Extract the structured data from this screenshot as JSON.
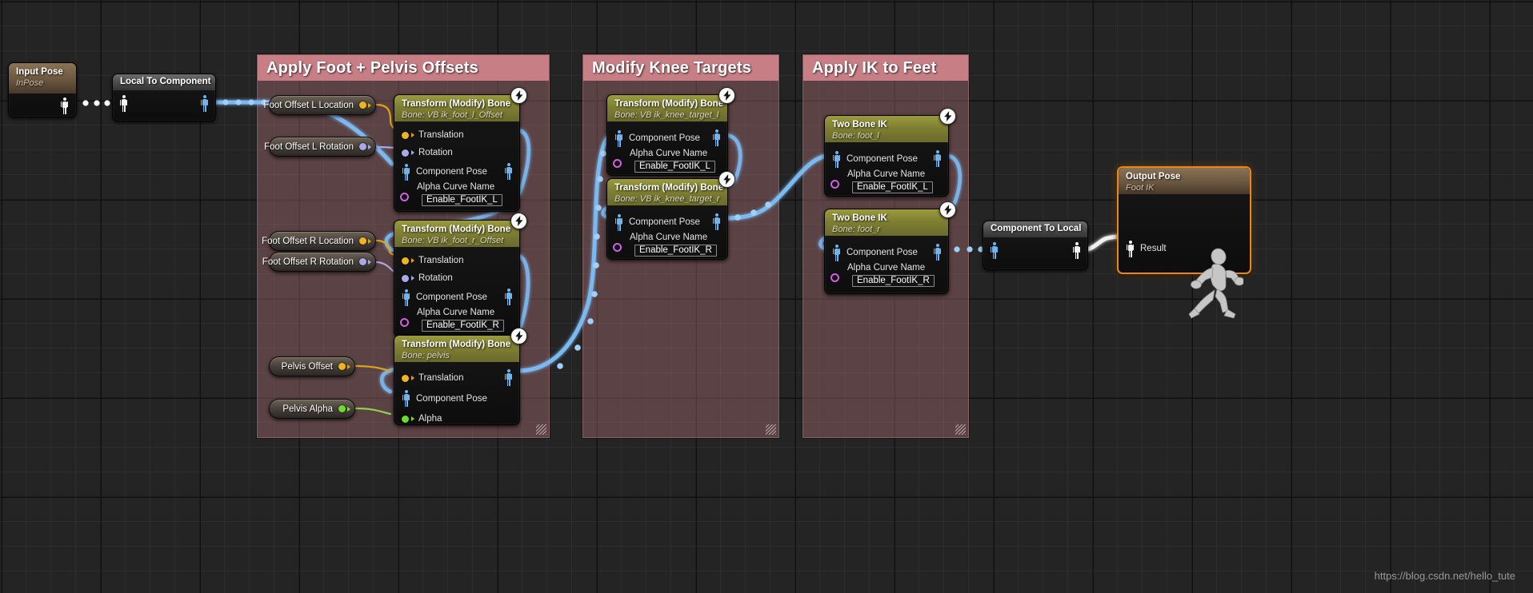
{
  "watermark": "https://blog.csdn.net/hello_tute",
  "colors": {
    "comment_fill": "#aa6e73",
    "comment_title_bar": "#c77e85",
    "node_header_olive": "#8f8f39",
    "node_header_grey": "#4a4a4a",
    "node_header_tan": "#6b5740",
    "result_border": "#e8871a",
    "pin_vector": "#f0b41e",
    "pin_rotator": "#a9a9e8",
    "pin_float": "#6cdb2a",
    "pin_name": "#d060e0",
    "pose_component": "#6fb4ef",
    "pose_local": "#f2f2f2",
    "background": "#242424"
  },
  "comments": [
    {
      "title": "Apply Foot + Pelvis Offsets"
    },
    {
      "title": "Modify Knee Targets"
    },
    {
      "title": "Apply IK to Feet"
    }
  ],
  "nodes": {
    "input_pose": {
      "title": "Input Pose",
      "subtitle": "InPose",
      "out_pin": "pose-local"
    },
    "local_to_component": {
      "title": "Local To Component",
      "in_pin": "pose-local",
      "out_pin": "pose-component"
    },
    "component_to_local": {
      "title": "Component To Local",
      "in_pin": "pose-component",
      "out_pin": "pose-local"
    },
    "output_pose": {
      "title": "Output Pose",
      "subtitle": "Foot IK",
      "result_label": "Result"
    },
    "transform_foot_l": {
      "title": "Transform (Modify) Bone",
      "subtitle": "Bone: VB ik_foot_l_Offset",
      "pins": [
        "Translation",
        "Rotation",
        "Component Pose"
      ],
      "curve_label": "Alpha Curve Name",
      "curve_value": "Enable_FootIK_L"
    },
    "transform_foot_r": {
      "title": "Transform (Modify) Bone",
      "subtitle": "Bone: VB ik_foot_r_Offset",
      "pins": [
        "Translation",
        "Rotation",
        "Component Pose"
      ],
      "curve_label": "Alpha Curve Name",
      "curve_value": "Enable_FootIK_R"
    },
    "transform_pelvis": {
      "title": "Transform (Modify) Bone",
      "subtitle": "Bone: pelvis",
      "pins": [
        "Translation",
        "Component Pose",
        "Alpha"
      ]
    },
    "transform_knee_l": {
      "title": "Transform (Modify) Bone",
      "subtitle": "Bone: VB ik_knee_target_l",
      "pins": [
        "Component Pose"
      ],
      "curve_label": "Alpha Curve Name",
      "curve_value": "Enable_FootIK_L"
    },
    "transform_knee_r": {
      "title": "Transform (Modify) Bone",
      "subtitle": "Bone: VB ik_knee_target_r",
      "pins": [
        "Component Pose"
      ],
      "curve_label": "Alpha Curve Name",
      "curve_value": "Enable_FootIK_R"
    },
    "two_bone_ik_l": {
      "title": "Two Bone IK",
      "subtitle": "Bone: foot_l",
      "pins": [
        "Component Pose"
      ],
      "curve_label": "Alpha Curve Name",
      "curve_value": "Enable_FootIK_L"
    },
    "two_bone_ik_r": {
      "title": "Two Bone IK",
      "subtitle": "Bone: foot_r",
      "pins": [
        "Component Pose"
      ],
      "curve_label": "Alpha Curve Name",
      "curve_value": "Enable_FootIK_R"
    }
  },
  "variables": [
    {
      "label": "Foot Offset L Location",
      "pin_type": "vector"
    },
    {
      "label": "Foot Offset L Rotation",
      "pin_type": "rotator"
    },
    {
      "label": "Foot Offset R Location",
      "pin_type": "vector"
    },
    {
      "label": "Foot Offset R Rotation",
      "pin_type": "rotator"
    },
    {
      "label": "Pelvis Offset",
      "pin_type": "vector"
    },
    {
      "label": "Pelvis Alpha",
      "pin_type": "float"
    }
  ],
  "pin_labels": {
    "translation": "Translation",
    "rotation": "Rotation",
    "component_pose": "Component Pose",
    "alpha": "Alpha",
    "result": "Result",
    "alpha_curve_name": "Alpha Curve Name"
  }
}
